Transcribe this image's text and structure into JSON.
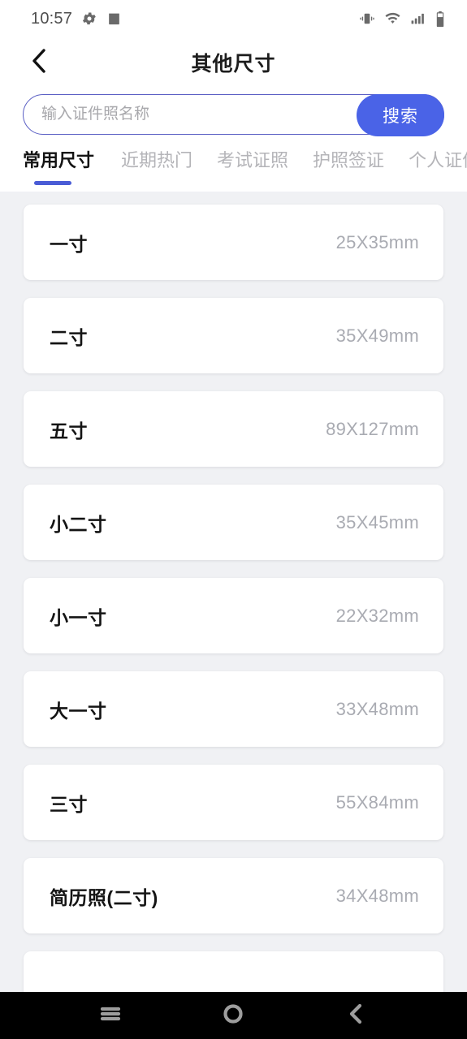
{
  "status_bar": {
    "time": "10:57",
    "left_icons": [
      "gear-icon",
      "shopping-bag-icon"
    ],
    "right_icons": [
      "vibrate-icon",
      "wifi-icon",
      "signal-icon",
      "battery-icon"
    ]
  },
  "header": {
    "back_icon": "chevron-left-icon",
    "title": "其他尺寸"
  },
  "search": {
    "placeholder": "输入证件照名称",
    "value": "",
    "button_label": "搜索",
    "button_color": "#4a63e7",
    "border_color": "#5a5fc4"
  },
  "tabs": {
    "active_index": 0,
    "underline_color": "#4a5cd6",
    "items": [
      {
        "label": "常用尺寸"
      },
      {
        "label": "近期热门"
      },
      {
        "label": "考试证照"
      },
      {
        "label": "护照签证"
      },
      {
        "label": "个人证件"
      }
    ]
  },
  "list": {
    "background": "#f0f1f4",
    "items": [
      {
        "name": "一寸",
        "size": "25X35mm"
      },
      {
        "name": "二寸",
        "size": "35X49mm"
      },
      {
        "name": "五寸",
        "size": "89X127mm"
      },
      {
        "name": "小二寸",
        "size": "35X45mm"
      },
      {
        "name": "小一寸",
        "size": "22X32mm"
      },
      {
        "name": "大一寸",
        "size": "33X48mm"
      },
      {
        "name": "三寸",
        "size": "55X84mm"
      },
      {
        "name": "简历照(二寸)",
        "size": "34X48mm"
      },
      {
        "name": "",
        "size": ""
      }
    ]
  },
  "navbar": {
    "recents_icon": "menu-icon",
    "home_icon": "circle-icon",
    "back_icon": "chevron-left-icon"
  }
}
